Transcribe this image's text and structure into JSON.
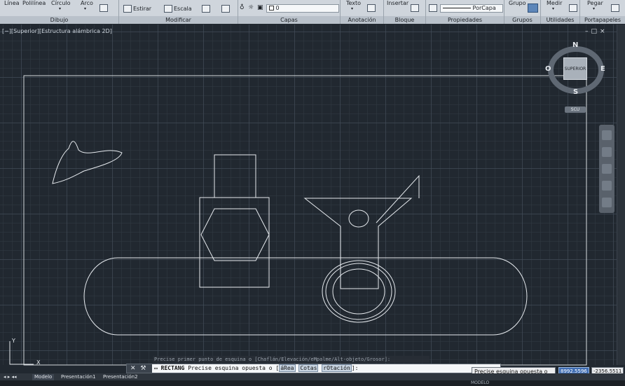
{
  "ribbon": {
    "dibujo": {
      "title": "Dibujo",
      "linea": "Línea",
      "polilinea": "Polilínea",
      "circulo": "Círculo",
      "arco": "Arco"
    },
    "modificar": {
      "title": "Modificar",
      "estirar": "Estirar",
      "escala": "Escala"
    },
    "capas": {
      "title": "Capas",
      "layer_value": "0"
    },
    "anotacion": {
      "title": "Anotación",
      "texto": "Texto"
    },
    "bloque": {
      "title": "Bloque",
      "insertar": "Insertar"
    },
    "propiedades": {
      "title": "Propiedades",
      "linetype_value": "PorCapa"
    },
    "grupos": {
      "title": "Grupos",
      "grupo": "Grupo"
    },
    "utilidades": {
      "title": "Utilidades",
      "medir": "Medir"
    },
    "portapapeles": {
      "title": "Portapapeles",
      "pegar": "Pegar"
    }
  },
  "viewport": {
    "label": "[−][Superior][Estructura alámbrica 2D]",
    "window_controls": "–□×"
  },
  "viewcube": {
    "north": "N",
    "south": "S",
    "east": "E",
    "west": "O",
    "face": "SUPERIOR",
    "ucs": "SCU"
  },
  "ucs_icon": {
    "x_label": "X",
    "y_label": "Y"
  },
  "command": {
    "history": "Precise primer punto de esquina o [Chaflán/Elevación/eMpalme/Alt-objeto/Grosor]:",
    "prefix": "RECTANG",
    "prompt": "Precise esquina opuesta o [",
    "opt_area": "áRea",
    "opt_cotas": "Cotas",
    "opt_rotacion": "rOtación",
    "suffix": "]:"
  },
  "tooltip": "Precise esquina opuesta o",
  "coords": {
    "x": "8992.5596",
    "y": "-2356.5511"
  },
  "tabs": {
    "modelo": "Modelo",
    "presentacion1": "Presentación1",
    "presentacion2": "Presentación2"
  },
  "statusbar": {
    "left": "",
    "model": "MODELO"
  }
}
